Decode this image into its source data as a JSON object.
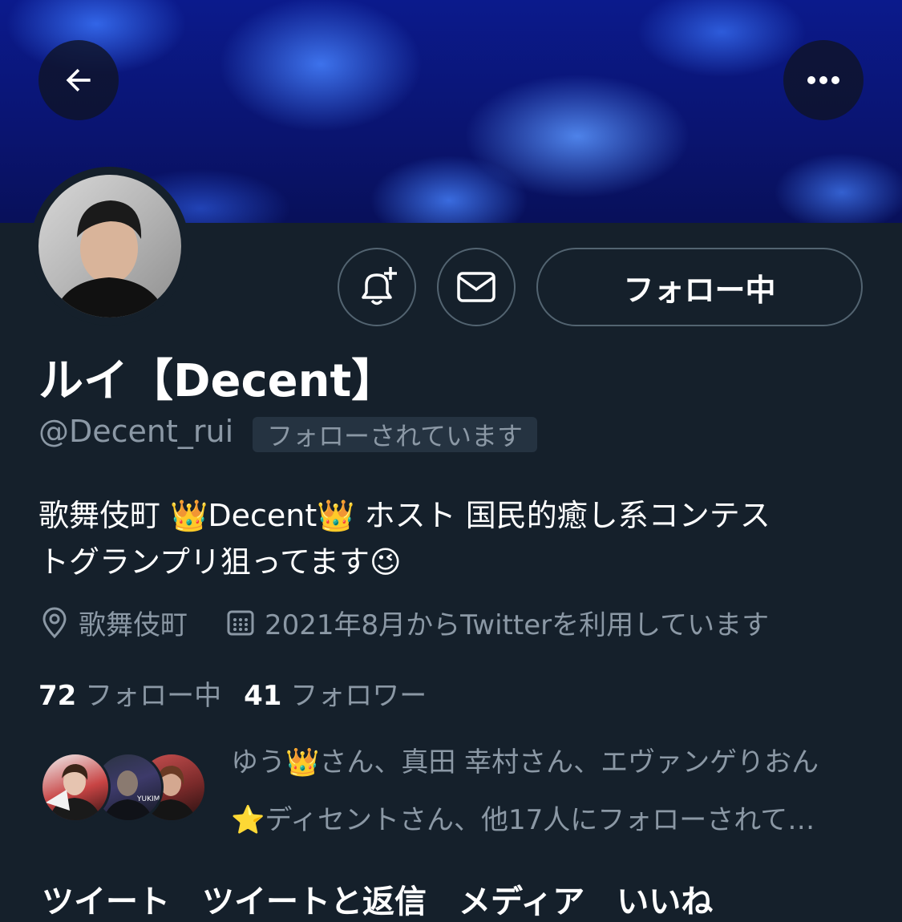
{
  "profile": {
    "display_name": "ルイ【Decent】",
    "handle": "@Decent_rui",
    "follows_you_badge": "フォローされています",
    "bio_line1": "歌舞伎町 👑Decent👑 ホスト 国民的癒し系コンテス",
    "bio_line2": "トグランプリ狙ってます😉",
    "location": "歌舞伎町",
    "joined": "2021年8月からTwitterを利用しています"
  },
  "actions": {
    "follow_button": "フォロー中"
  },
  "stats": {
    "following_count": "72",
    "following_label": "フォロー中",
    "followers_count": "41",
    "followers_label": "フォロワー"
  },
  "mutual": {
    "line1": "ゆう👑さん、真田 幸村さん、エヴァンゲりおん",
    "line2": "⭐ディセントさん、他17人にフォローされて…",
    "avatar2_text": "YUKIM"
  },
  "tabs_peek": "ツイート　ツイートと返信　メディア　いいね",
  "colors": {
    "background": "#15202b",
    "muted_text": "#8b98a5",
    "border": "#536471",
    "banner_blue": "#0b1a8c"
  },
  "icons": [
    "back-arrow-icon",
    "more-dots-icon",
    "bell-plus-icon",
    "mail-icon",
    "location-pin-icon",
    "calendar-icon"
  ]
}
